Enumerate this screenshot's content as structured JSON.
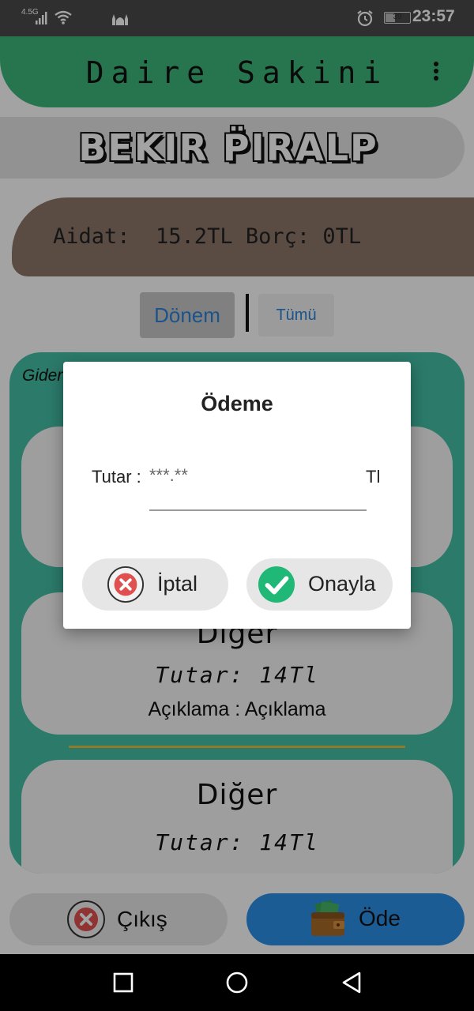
{
  "status_bar": {
    "network": "4.5G",
    "battery": "39",
    "time": "23:57"
  },
  "app_bar": {
    "title": "Daire Sakini",
    "menu_icon": "more-vert-icon"
  },
  "resident": {
    "name": "BEKIR P̈IRALP"
  },
  "summary": {
    "text": "Aidat:  15.2TL Borç: 0TL"
  },
  "tabs": [
    {
      "label": "Dönem",
      "selected": true
    },
    {
      "label": "Tümü",
      "selected": false
    }
  ],
  "expenses": {
    "header": "Gider",
    "items": [
      {
        "title": "Diğer",
        "amount": "Tutar: 14Tl",
        "description": "Açıklama : Açıklama"
      },
      {
        "title": "Diğer",
        "amount": "Tutar: 14Tl"
      }
    ]
  },
  "bottom": {
    "exit_label": "Çıkış",
    "pay_label": "Öde",
    "exit_icon": "cancel-circle-icon",
    "pay_icon": "wallet-money-icon"
  },
  "dialog": {
    "title": "Ödeme",
    "amount_label": "Tutar :",
    "amount_placeholder": "***.**",
    "amount_unit": "Tl",
    "cancel_label": "İptal",
    "confirm_label": "Onayla",
    "cancel_icon": "cancel-circle-icon",
    "confirm_icon": "check-circle-icon"
  },
  "colors": {
    "app_bar": "#3db87a",
    "summary_card": "#8d786a",
    "list_panel": "#44bfa6",
    "pay_button": "#2c90e8",
    "tab_text": "#2b82d8"
  }
}
